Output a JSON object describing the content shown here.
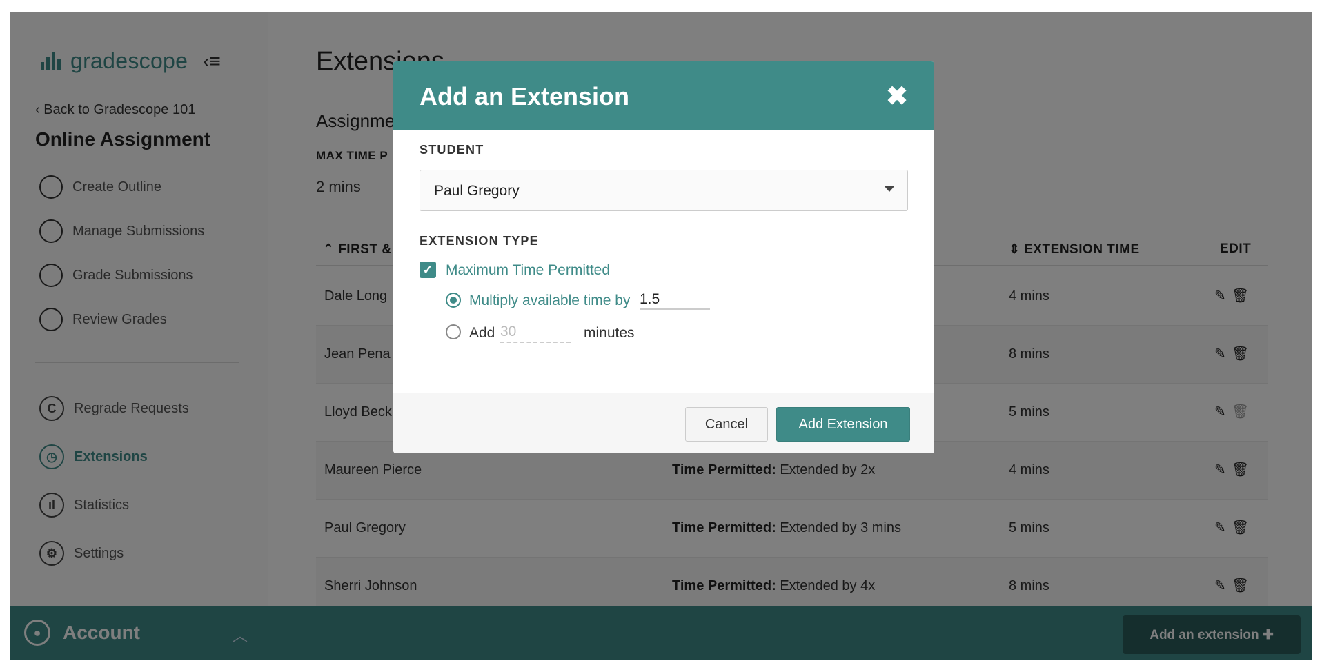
{
  "sidebar": {
    "logo_text": "gradescope",
    "back_link": "‹ Back to Gradescope 101",
    "assignment_title": "Online Assignment",
    "steps": [
      "Create Outline",
      "Manage Submissions",
      "Grade Submissions",
      "Review Grades"
    ],
    "tools": [
      {
        "label": "Regrade Requests",
        "icon": "regrade-icon",
        "glyph": "C"
      },
      {
        "label": "Extensions",
        "icon": "clock-icon",
        "glyph": "◷",
        "active": true
      },
      {
        "label": "Statistics",
        "icon": "statistics-icon",
        "glyph": "ıl"
      },
      {
        "label": "Settings",
        "icon": "gear-icon",
        "glyph": "⚙"
      }
    ]
  },
  "bottombar": {
    "account_label": "Account",
    "add_extension_label": "Add an extension ✚"
  },
  "main": {
    "title": "Extensions",
    "assignment_label": "Assignme",
    "max_time_label": "MAX TIME P",
    "max_time_value": "2 mins",
    "table": {
      "headers": {
        "name": "⌃ FIRST &",
        "time": "⇕ EXTENSION TIME",
        "edit": "EDIT"
      },
      "rows": [
        {
          "name": "Dale Long",
          "type_label": "",
          "type_value": "",
          "time": "4 mins"
        },
        {
          "name": "Jean Pena",
          "type_label": "",
          "type_value": "",
          "time": "8 mins"
        },
        {
          "name": "Lloyd Beck",
          "type_label": "",
          "type_value": "",
          "time": "5 mins"
        },
        {
          "name": "Maureen Pierce",
          "type_label": "Time Permitted:",
          "type_value": " Extended by 2x",
          "time": "4 mins"
        },
        {
          "name": "Paul Gregory",
          "type_label": "Time Permitted:",
          "type_value": " Extended by 3 mins",
          "time": "5 mins"
        },
        {
          "name": "Sherri Johnson",
          "type_label": "Time Permitted:",
          "type_value": " Extended by 4x",
          "time": "8 mins"
        }
      ]
    }
  },
  "modal": {
    "title": "Add an Extension",
    "close_glyph": "✖",
    "student_label": "STUDENT",
    "student_value": "Paul Gregory",
    "ext_type_label": "EXTENSION TYPE",
    "checkbox_label": "Maximum Time Permitted",
    "checkbox_glyph": "✓",
    "multiply_label": "Multiply available time by",
    "multiply_value": "1.5",
    "add_label": "Add",
    "add_placeholder": "30",
    "add_unit": "minutes",
    "cancel_label": "Cancel",
    "submit_label": "Add Extension"
  },
  "colors": {
    "accent": "#3f8b88",
    "overlay": "rgba(0,0,0,0.5)"
  }
}
